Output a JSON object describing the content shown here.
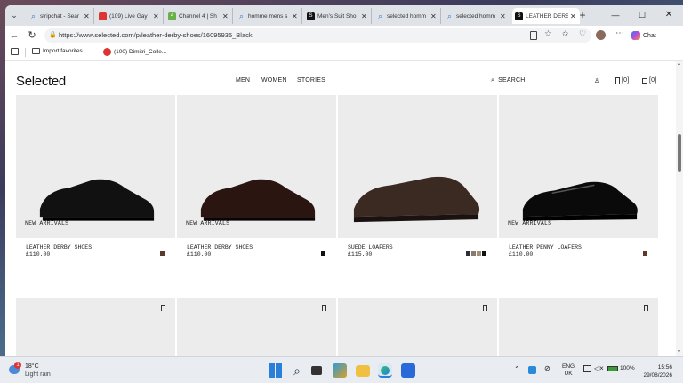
{
  "browser": {
    "tabs": [
      {
        "label": "stripchat - Sear",
        "icon": "search-icon",
        "active": false
      },
      {
        "label": "(109) Live Gay",
        "icon": "red-chat-icon",
        "active": false
      },
      {
        "label": "Channel 4 | Sh",
        "icon": "channel4-icon",
        "active": false
      },
      {
        "label": "homme mens s",
        "icon": "search-icon",
        "active": false
      },
      {
        "label": "Men's Suit Sho",
        "icon": "selected-s-icon",
        "active": false
      },
      {
        "label": "selected homm",
        "icon": "search-icon",
        "active": false
      },
      {
        "label": "selected homm",
        "icon": "search-icon",
        "active": false
      },
      {
        "label": "LEATHER DERB",
        "icon": "selected-s-icon",
        "active": true
      }
    ],
    "url": "https://www.selected.com/p/leather-derby-shoes/16095935_Black",
    "chat_label": "Chat",
    "favorites": [
      {
        "label": "Import favorites"
      },
      {
        "label": "(100) Dimitri_Colle..."
      }
    ]
  },
  "site": {
    "logo": "Selected",
    "nav": {
      "men": "MEN",
      "women": "WOMEN",
      "stories": "STORIES"
    },
    "search": "SEARCH",
    "wishlist_count": "[0]",
    "bag_count": "[0]",
    "products": [
      {
        "badge": "NEW ARRIVALS",
        "name": "LEATHER DERBY SHOES",
        "price": "£110.00",
        "shoe": "derby-black",
        "swatches": [
          "#5a3a2a"
        ]
      },
      {
        "badge": "NEW ARRIVALS",
        "name": "LEATHER DERBY SHOES",
        "price": "£110.00",
        "shoe": "derby-brown",
        "swatches": [
          "#111111"
        ]
      },
      {
        "badge": "",
        "name": "SUEDE LOAFERS",
        "price": "£115.00",
        "shoe": "loafer-suede",
        "swatches": [
          "#2a2f3a",
          "#8a7a6a",
          "#a09080",
          "#111111"
        ]
      },
      {
        "badge": "NEW ARRIVALS",
        "name": "LEATHER PENNY LOAFERS",
        "price": "£110.00",
        "shoe": "penny-black",
        "swatches": [
          "#5a3a2a"
        ]
      }
    ]
  },
  "taskbar": {
    "weather_temp": "18°C",
    "weather_desc": "Light rain",
    "weather_badge": "1",
    "lang": "ENG",
    "region": "UK",
    "battery": "100%",
    "time": "15:56",
    "date": "29/08/2026"
  }
}
